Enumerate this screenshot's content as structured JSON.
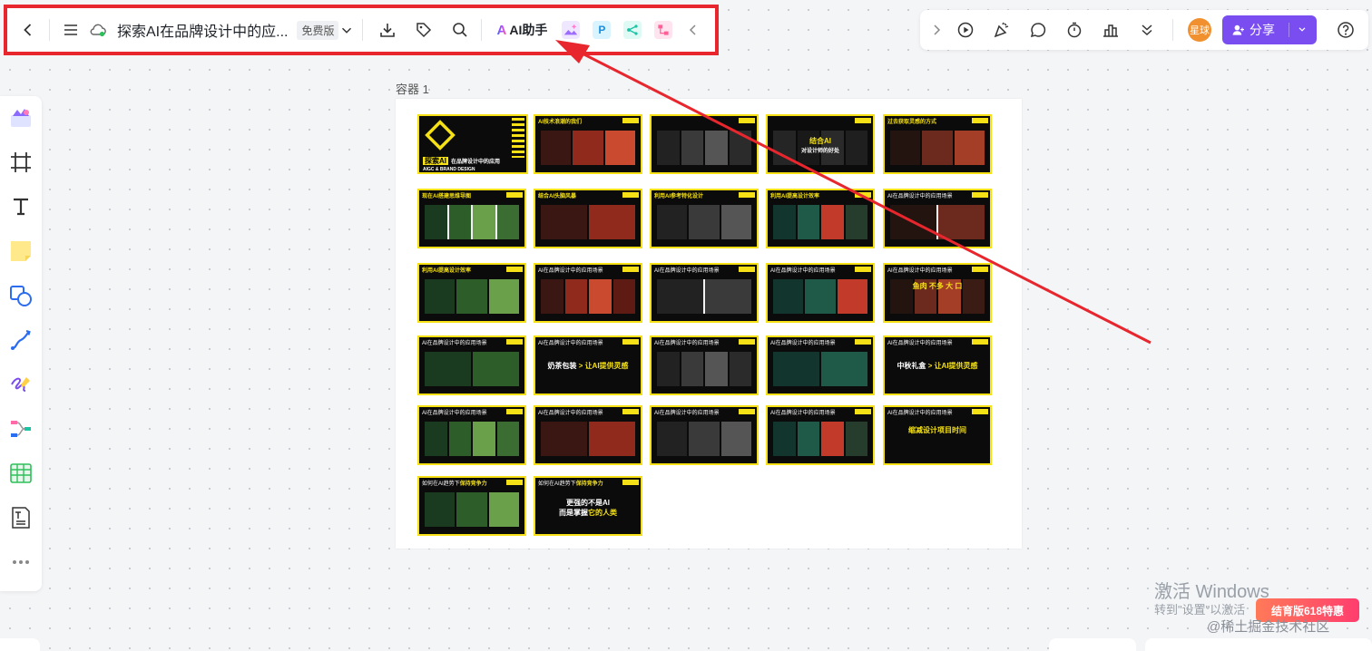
{
  "toolbar": {
    "doc_title": "探索AI在品牌设计中的应...",
    "plan_badge": "免费版",
    "ai_assistant_mark": "A",
    "ai_assistant_label": "AI助手",
    "app_p_label": "P"
  },
  "toolbar_right": {
    "avatar_text": "星球",
    "share_label": "分享"
  },
  "canvas": {
    "container_label": "容器 1",
    "slides": [
      {
        "title": "",
        "hl": ""
      },
      {
        "title": "",
        "hl": "AI技术浪潮的我们"
      },
      {
        "title": "",
        "hl": ""
      },
      {
        "title": "",
        "hl": ""
      },
      {
        "title": "",
        "hl": "过去获取灵感的方式"
      },
      {
        "title": "",
        "hl": "现在AI搭建思维导图"
      },
      {
        "title": "",
        "hl": "结合AI头脑风暴"
      },
      {
        "title": "",
        "hl": "利用AI参考特化设计"
      },
      {
        "title": "",
        "hl": "利用AI提高设计效率"
      },
      {
        "title": "AI在品牌设计中的应用场景",
        "hl": ""
      },
      {
        "title": "",
        "hl": "利用AI提高设计效率"
      },
      {
        "title": "AI在品牌设计中的应用场景",
        "hl": ""
      },
      {
        "title": "AI在品牌设计中的应用场景",
        "hl": ""
      },
      {
        "title": "AI在品牌设计中的应用场景",
        "hl": ""
      },
      {
        "title": "AI在品牌设计中的应用场景",
        "hl": ""
      },
      {
        "title": "AI在品牌设计中的应用场景",
        "hl": ""
      },
      {
        "title": "AI在品牌设计中的应用场景",
        "hl": ""
      },
      {
        "title": "AI在品牌设计中的应用场景",
        "hl": ""
      },
      {
        "title": "AI在品牌设计中的应用场景",
        "hl": ""
      },
      {
        "title": "AI在品牌设计中的应用场景",
        "hl": ""
      },
      {
        "title": "AI在品牌设计中的应用场景",
        "hl": ""
      },
      {
        "title": "AI在品牌设计中的应用场景",
        "hl": ""
      },
      {
        "title": "AI在品牌设计中的应用场景",
        "hl": ""
      },
      {
        "title": "AI在品牌设计中的应用场景",
        "hl": ""
      },
      {
        "title": "AI在品牌设计中的应用场景",
        "hl": ""
      },
      {
        "title": "如何在AI趋势下",
        "hl": "保持竞争力"
      },
      {
        "title": "如何在AI趋势下",
        "hl": "保持竞争力"
      }
    ],
    "cover_big": "探索AI",
    "cover_sub": "在品牌设计中的应用",
    "cover_en": "AIGC & BRAND DESIGN",
    "slide4_big": "结合AI",
    "slide4_sub": "对设计师的好处",
    "slide15_big": "鱼肉 不多 大 口",
    "slide17_a": "奶茶包装",
    "slide17_b": "让AI提供灵感",
    "slide20_a": "中秋礼盒",
    "slide20_b": "让AI提供灵感",
    "slide25_big": "缩减设计项目时间",
    "slide27_a": "更强的不是AI",
    "slide27_b_white": "而是掌握",
    "slide27_b_yellow": "它的人类"
  },
  "system": {
    "watermark_title": "激活 Windows",
    "watermark_sub": "转到\"设置\"以激活",
    "promo": "结育版618特惠",
    "credit": "@稀土掘金技术社区"
  }
}
